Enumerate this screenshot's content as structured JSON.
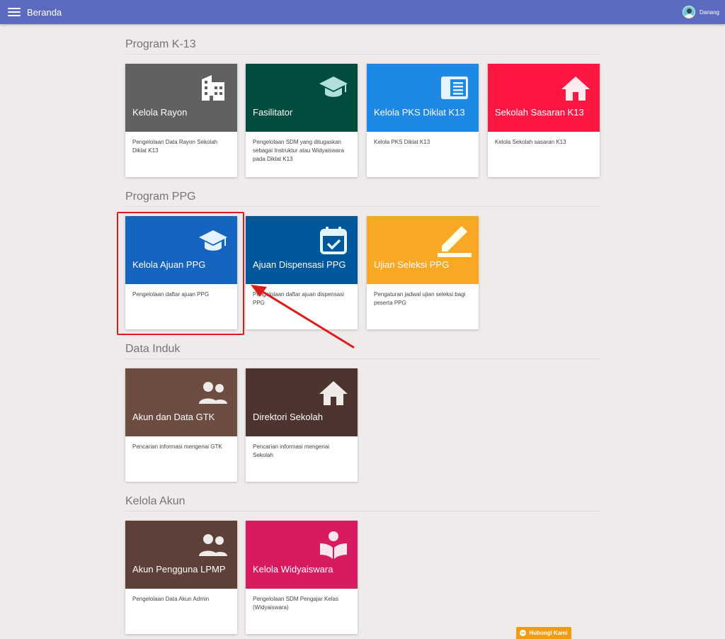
{
  "topbar": {
    "title": "Beranda",
    "user_name": "Danang",
    "menu_icon": "menu-icon",
    "color": "#5c6bc0"
  },
  "sections": [
    {
      "title": "Program K-13",
      "cards": [
        {
          "title": "Kelola Rayon",
          "desc": "Pengelolaan Data Rayon Sekolah Diklat K13",
          "icon": "building-icon",
          "color": "#616161"
        },
        {
          "title": "Fasilitator",
          "desc": "Pengelolaan SDM yang ditugaskan sebagai Instruktur atau Widyaiswara pada Diklat K13",
          "icon": "graduation-cap-icon",
          "color": "#004d40"
        },
        {
          "title": "Kelola PKS Diklat K13",
          "desc": "Kelola PKS Diklat K13",
          "icon": "document-icon",
          "color": "#1e88e5"
        },
        {
          "title": "Sekolah Sasaran K13",
          "desc": "Kelola Sekolah sasaran K13",
          "icon": "home-icon",
          "color": "#ff1744"
        }
      ]
    },
    {
      "title": "Program PPG",
      "cards": [
        {
          "title": "Kelola Ajuan PPG",
          "desc": "Pengelolaan daftar ajuan PPG",
          "icon": "graduation-cap-icon",
          "color": "#1565c0"
        },
        {
          "title": "Ajuan Dispensasi PPG",
          "desc": "Pengelolaan daftar ajuan dispensasi PPG",
          "icon": "calendar-check-icon",
          "color": "#01579b"
        },
        {
          "title": "Ujian Seleksi PPG",
          "desc": "Pengaturan jadwal ujian seleksi bagi peserta PPG",
          "icon": "pencil-icon",
          "color": "#f9a825"
        }
      ]
    },
    {
      "title": "Data Induk",
      "cards": [
        {
          "title": "Akun dan Data GTK",
          "desc": "Pencarian informasi mengenai GTK",
          "icon": "people-icon",
          "color": "#6d4c41"
        },
        {
          "title": "Direktori Sekolah",
          "desc": "Pencarian informasi mengenai Sekolah",
          "icon": "home-icon",
          "color": "#4e342e"
        }
      ]
    },
    {
      "title": "Kelola Akun",
      "cards": [
        {
          "title": "Akun Pengguna LPMP",
          "desc": "Pengelolaan Data Akun Admin",
          "icon": "people-icon",
          "color": "#5d4037"
        },
        {
          "title": "Kelola Widyaiswara",
          "desc": "Pengelolaan SDM Pengajar Kelas (Widyaiswara)",
          "icon": "book-reader-icon",
          "color": "#d81b60"
        }
      ]
    }
  ],
  "contact": {
    "label": "Hubungi Kami",
    "color": "#f39c12"
  },
  "annotation": {
    "highlight_color": "#e01b1b"
  }
}
